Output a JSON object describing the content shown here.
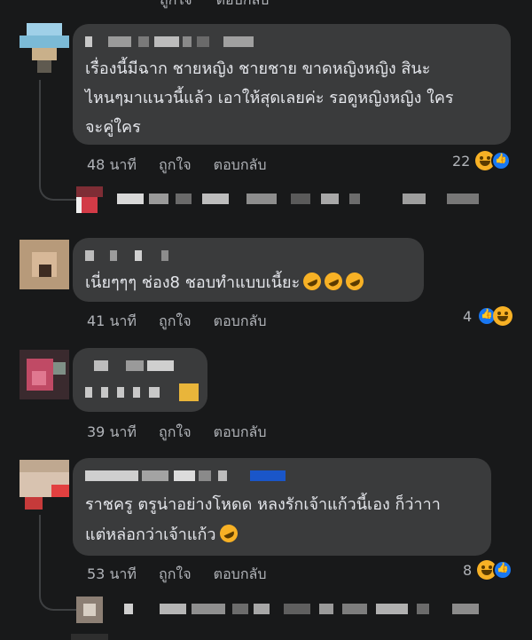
{
  "comments": [
    {
      "text_lines": [
        "เรื่องนี้มีฉาก ชายหญิง ชายชาย ขาดหญิงหญิง สินะ",
        "ไหนๆมาแนวนี้แล้ว เอาให้สุดเลยค่ะ รอดูหญิงหญิง ใคร",
        "จะคู่ใคร"
      ],
      "time": "48 นาที",
      "like_label": "ถูกใจ",
      "reply_label": "ตอบกลับ",
      "reaction_count": "22"
    },
    {
      "text_lines": [
        "เนี่ยๆๆๆ ช่อง8 ชอบทำแบบเนี้ยะ"
      ],
      "time": "41 นาที",
      "like_label": "ถูกใจ",
      "reply_label": "ตอบกลับ",
      "reaction_count": "4"
    },
    {
      "text_lines": [],
      "time": "39 นาที",
      "like_label": "ถูกใจ",
      "reply_label": "ตอบกลับ",
      "reaction_count": ""
    },
    {
      "text_lines": [
        "ราชครู ตรูน่าอย่างโหดด หลงรักเจ้าแก้วนี้เอง ก็ว่าาา",
        "แต่หล่อกว่าเจ้าแก้ว"
      ],
      "time": "53 นาที",
      "like_label": "ถูกใจ",
      "reply_label": "ตอบกลับ",
      "reaction_count": "8"
    }
  ],
  "top_partial": {
    "like_label": "ถูกใจ",
    "reply_label": "ตอบกลับ"
  },
  "colors": {
    "background": "#18191a",
    "bubble": "#3a3b3c",
    "text": "#e4e6eb",
    "meta": "#b0b3b8"
  }
}
